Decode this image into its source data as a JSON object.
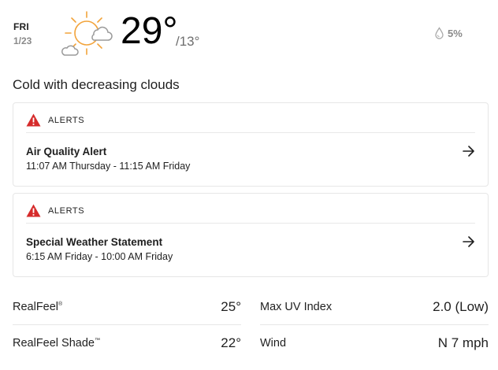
{
  "header": {
    "day_of_week": "FRI",
    "date": "1/23",
    "weather_icon": "sun-with-clouds-icon",
    "high_temp": "29°",
    "low_temp": "/13°",
    "precip_icon": "raindrop-icon",
    "precip_probability": "5%"
  },
  "phrase": "Cold with decreasing clouds",
  "alerts": [
    {
      "label": "ALERTS",
      "title": "Air Quality Alert",
      "time": "11:07 AM Thursday - 11:15 AM Friday"
    },
    {
      "label": "ALERTS",
      "title": "Special Weather Statement",
      "time": "6:15 AM Friday - 10:00 AM Friday"
    }
  ],
  "details": {
    "realfeel": {
      "label": "RealFeel",
      "mark": "®",
      "value": "25°"
    },
    "realfeel_shade": {
      "label": "RealFeel Shade",
      "mark": "™",
      "value": "22°"
    },
    "max_uv": {
      "label": "Max UV Index",
      "value": "2.0 (Low)"
    },
    "wind": {
      "label": "Wind",
      "value": "N 7 mph"
    }
  },
  "colors": {
    "alert_red": "#d62b2b",
    "sun_orange": "#f2a33a",
    "cloud_gray": "#9a9a9a"
  }
}
